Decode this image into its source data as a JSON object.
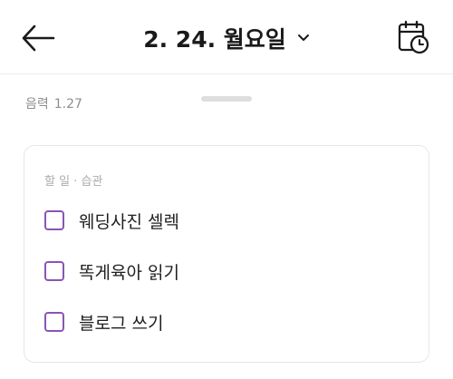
{
  "header": {
    "title": "2. 24. 월요일",
    "back_icon": "arrow-left-icon",
    "dropdown_icon": "chevron-down-icon",
    "calendar_icon": "calendar-clock-icon"
  },
  "lunar": {
    "label": "음력",
    "date": "1.27"
  },
  "card": {
    "section_label": "할 일 · 습관",
    "tasks": [
      {
        "label": "웨딩사진 셀렉",
        "checked": false
      },
      {
        "label": "똑게육아 읽기",
        "checked": false
      },
      {
        "label": "블로그 쓰기",
        "checked": false
      }
    ]
  },
  "colors": {
    "checkbox_border": "#8a54b8",
    "text_primary": "#1d1d1d",
    "text_muted": "#8d8d8d"
  }
}
